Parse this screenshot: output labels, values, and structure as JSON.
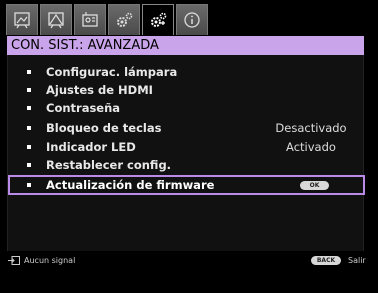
{
  "tabs": [
    {
      "icon": "picture-icon"
    },
    {
      "icon": "display-icon"
    },
    {
      "icon": "setup-icon"
    },
    {
      "icon": "gear-basic-icon"
    },
    {
      "icon": "gear-advanced-icon"
    },
    {
      "icon": "info-icon"
    }
  ],
  "header": {
    "title": "CON. SIST.: AVANZADA"
  },
  "menu": {
    "items": [
      {
        "label": "Configurac. lámpara",
        "value": ""
      },
      {
        "label": "Ajustes de HDMI",
        "value": ""
      },
      {
        "label": "Contraseña",
        "value": ""
      },
      {
        "label": "Bloqueo de teclas",
        "value": "Desactivado"
      },
      {
        "label": "Indicador LED",
        "value": "Activado"
      },
      {
        "label": "Restablecer config.",
        "value": ""
      },
      {
        "label": "Actualización de firmware",
        "value": "OK"
      }
    ]
  },
  "footer": {
    "signal": "Aucun signal",
    "back_label": "BACK",
    "exit_label": "Salir"
  },
  "colors": {
    "accent": "#c9a4ea",
    "selected_border": "#b98ae8"
  }
}
